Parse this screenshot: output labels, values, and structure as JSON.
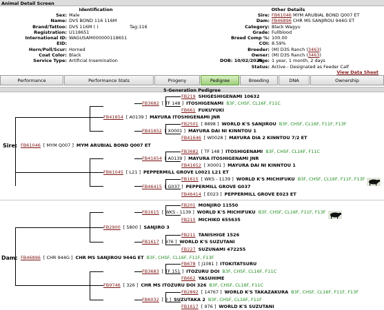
{
  "window_title": "Animal Detail Screen",
  "identification": {
    "heading": "Identification",
    "rows": [
      {
        "label": "Sex:",
        "value": "Male"
      },
      {
        "label": "Name:",
        "value": "DVS BOND 116 116M"
      },
      {
        "label": "Brand/Tattoo:",
        "value": "DVS 116M ( )"
      },
      {
        "label": "Registration:",
        "value": "U118651"
      },
      {
        "label": "International ID:",
        "value": "WAGUSAM000000118651"
      },
      {
        "label": "EID:",
        "value": ""
      },
      {
        "label": "Horn/Poll/Scur:",
        "value": "Horned"
      },
      {
        "label": "Coat Color:",
        "value": "Black"
      },
      {
        "label": "Service Type:",
        "value": "Artificial Insemination"
      }
    ],
    "tag": "Tag:116"
  },
  "other_details": {
    "heading": "Other Details",
    "sire_label": "Sire:",
    "sire_id": "FB61046",
    "sire_name": "MYM ARUBIAL BOND Q007 ET",
    "dam_label": "Dam:",
    "dam_id": "FB46896",
    "dam_name": "CHR MS SANJIROU 944G ET",
    "category_label": "Category:",
    "category": "Black Wagyu",
    "grade_label": "Grade:",
    "grade": "Fullblood",
    "breed_label": "Breed Comp %:",
    "breed": "100.00",
    "coi_label": "COI:",
    "coi": "8.59%",
    "breeder_label": "Breeder:",
    "breeder": "(M) D3S Ranch (",
    "breeder_link": "3463",
    "breeder_end": ")",
    "owner_label": "Owner:",
    "owner": "(M) D3S Ranch (",
    "owner_link": "3463",
    "owner_end": ")",
    "dob": "DOB: 10/02/2024",
    "age_label": "Age:",
    "age": "1 year, 1 month, 2 days",
    "status_label": "Status:",
    "status": "Active - Designated as Feeder Calf",
    "view_link": "View Data Sheet"
  },
  "tabs": [
    "Performance",
    "Performance Stats",
    "Progeny",
    "Pedigree",
    "Breeding",
    "DNA",
    "Ownership"
  ],
  "active_tab": "Pedigree",
  "pedigree": {
    "heading": "5-Generation Pedigree",
    "sire_label": "Sire:",
    "dam_label": "Dam:",
    "nodes": [
      {
        "id": "FB219",
        "bk": "",
        "nm": "SHIGESHIGENAMI 10632",
        "ep": ""
      },
      {
        "id": "FB3682",
        "bk": "[ TF 148 ]",
        "nm": "ITOSHIGENAMI",
        "ep": "B3F, CHSF, CL16F, F11C"
      },
      {
        "id": "FB661",
        "bk": "",
        "nm": "FUKUYUKI",
        "ep": ""
      },
      {
        "id": "FB41654",
        "bk": "[ A0139 ]",
        "nm": "MAYURA ITOSHIGENAMI JNR",
        "ep": ""
      },
      {
        "id": "FB2501",
        "bk": "[ 8898 ]",
        "nm": "WORLD K'S SANJIROU",
        "ep": "B3F, CHSF, CL16F, F11F, F13F"
      },
      {
        "id": "FB41652",
        "bk": "[ X0001 ]",
        "nm": "MAYURA DAI NI KINNTOU 1",
        "ep": ""
      },
      {
        "id": "FB41646",
        "bk": "[ W0028 ]",
        "nm": "MAYURA DIA 2 KINNTOU 7/2 ET",
        "ep": ""
      },
      {
        "id": "FB61046",
        "bk": "[ MYM Q007 ]",
        "nm": "MYM ARUBIAL BOND Q007 ET",
        "ep": ""
      },
      {
        "id": "FB3682",
        "bk": "[ TF 148 ]",
        "nm": "ITOSHIGENAMI",
        "ep": "B3F, CHSF, CL16F, F11C"
      },
      {
        "id": "FB41654",
        "bk": "[ A0139 ]",
        "nm": "MAYURA ITOSHIGENAMI JNR",
        "ep": ""
      },
      {
        "id": "FB41652",
        "bk": "[ X0001 ]",
        "nm": "MAYURA DAI NI KINNTOU 1",
        "ep": ""
      },
      {
        "id": "FB61045",
        "bk": "[ L21 ]",
        "nm": "PEPPERMILL GROVE L0021 L21 ET",
        "ep": ""
      },
      {
        "id": "FB1615",
        "bk": "[ WKS - 1139 ]",
        "nm": "WORLD K'S MICHIFUKU",
        "ep": "B3F, CHSF, CL16F, F11F, F13F"
      },
      {
        "id": "FB46415",
        "bk": "[ G037 ]",
        "nm": "PEPPERMILL GROVE G037",
        "ep": ""
      },
      {
        "id": "FB46414",
        "bk": "[ E023 ]",
        "nm": "PEPPERMILL GROVE E023 ET",
        "ep": ""
      },
      {
        "id": "FB201",
        "bk": "",
        "nm": "MONJIRO 11550",
        "ep": ""
      },
      {
        "id": "FB1615",
        "bk": "[ WKS - 1139 ]",
        "nm": "WORLD K'S MICHIFUKU",
        "ep": "B3F, CHSF, CL16F, F11F, F13F"
      },
      {
        "id": "FB215",
        "bk": "",
        "nm": "MICHIKO 655635",
        "ep": ""
      },
      {
        "id": "FB2900",
        "bk": "[ 5800 ]",
        "nm": "SANJIRO 3",
        "ep": ""
      },
      {
        "id": "FB211",
        "bk": "",
        "nm": "TANISHIGE 1526",
        "ep": ""
      },
      {
        "id": "FB1617",
        "bk": "[ 976 ]",
        "nm": "WORLD K'S SUZUTANI",
        "ep": ""
      },
      {
        "id": "FB227",
        "bk": "",
        "nm": "SUZUNAMI 472255",
        "ep": ""
      },
      {
        "id": "FB46896",
        "bk": "[ CHR 944G ]",
        "nm": "CHR MS SANJIROU 944G ET",
        "ep": "B3F, CHSF, CL16F, F11F, F13F"
      },
      {
        "id": "FB678",
        "bk": "[ J1081 ]",
        "nm": "ITOKITATSURU",
        "ep": ""
      },
      {
        "id": "FB3683",
        "bk": "[ TF 151 ]",
        "nm": "ITOZURU DOI",
        "ep": "B3F, CHSF, CL16F, F11C"
      },
      {
        "id": "FB662",
        "bk": "",
        "nm": "YASUHIME",
        "ep": ""
      },
      {
        "id": "FB9746",
        "bk": "[ 326 ]",
        "nm": "CHR MS ITOZURU DOI 326",
        "ep": "B3F, CHSF, CL16F, F11C"
      },
      {
        "id": "FB2892",
        "bk": "[ 14767 ]",
        "nm": "WORLD K'S TAKAZAKURA",
        "ep": "B3F, CHSF, CL16F, F11F, F13F"
      },
      {
        "id": "FB6032",
        "bk": "[ 2 ]",
        "nm": "SUZUTAKA 2",
        "ep": "B3F, CHSF, CL16F, F11F"
      },
      {
        "id": "FB1617",
        "bk": "[ 976 ]",
        "nm": "WORLD K'S SUZUTANI",
        "ep": ""
      }
    ]
  },
  "colors": {
    "link": "#7a1010",
    "epd_green": "#1c8a1c",
    "active_tab": "#9ecf7c"
  }
}
